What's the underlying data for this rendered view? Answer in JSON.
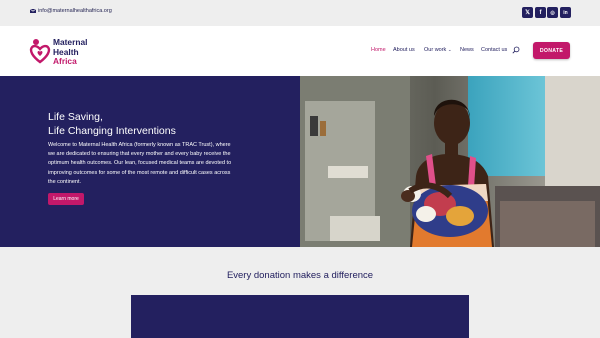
{
  "topbar": {
    "email": "info@maternalhealthafrica.org",
    "social": [
      {
        "icon": "x-icon",
        "glyph": "𝕏"
      },
      {
        "icon": "facebook-icon",
        "glyph": "f"
      },
      {
        "icon": "instagram-icon",
        "glyph": "◎"
      },
      {
        "icon": "linkedin-icon",
        "glyph": "in"
      }
    ]
  },
  "logo": {
    "line1": "Maternal",
    "line2": "Health",
    "line3": "Africa"
  },
  "nav": {
    "home": "Home",
    "about": "About us",
    "work": "Our work",
    "news": "News",
    "contact": "Contact us",
    "donate": "DONATE"
  },
  "hero": {
    "title_line1": "Life Saving,",
    "title_line2": "Life Changing Interventions",
    "body": "Welcome to Maternal Health Africa (formerly known as TRAC Trust), where we are dedicated to ensuring that every mother and every baby receive the optimum health outcomes. Our lean, focused medical teams are devoted to improving outcomes for some of the most remote and difficult cases across the continent.",
    "button": "Learn more"
  },
  "section": {
    "title": "Every donation makes a difference"
  },
  "colors": {
    "navy": "#23205f",
    "magenta": "#c2186a",
    "background": "#eeeeee"
  }
}
